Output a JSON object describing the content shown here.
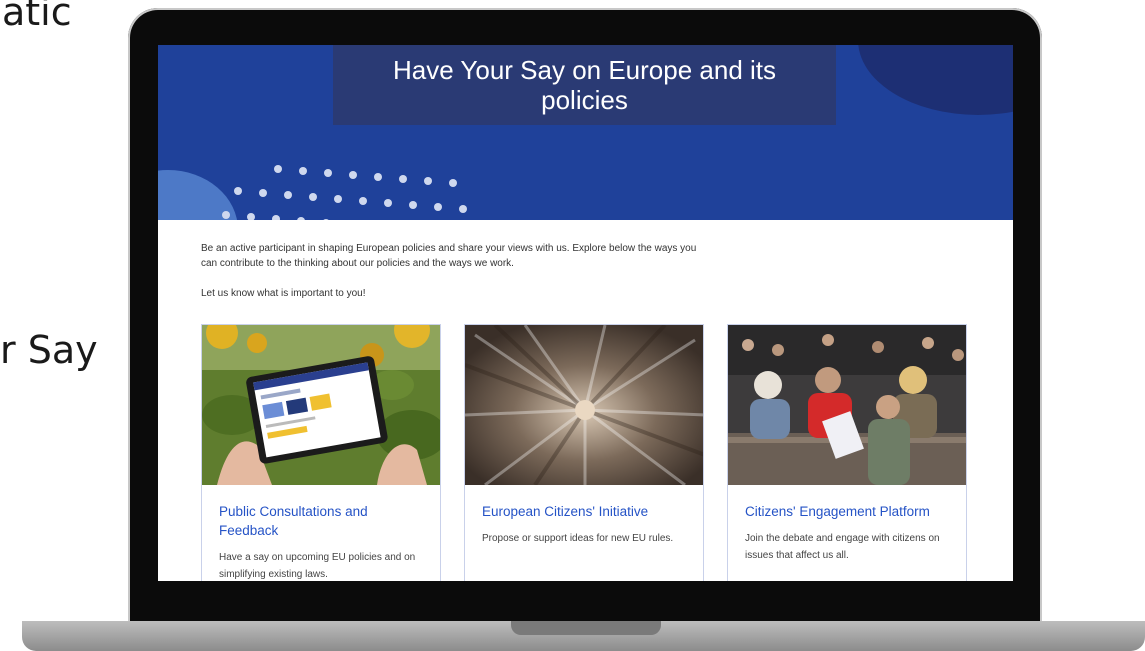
{
  "background": {
    "text_top": "atic",
    "text_mid": "r Say"
  },
  "hero": {
    "title": "Have Your Say on Europe and its policies",
    "colors": {
      "banner": "#1f419a",
      "title_box": "#2a3a74"
    }
  },
  "intro": {
    "paragraph": "Be an active participant in shaping European policies and share your views with us. Explore below the ways you can contribute to the thinking about our policies and the ways we work.",
    "call_to_action": "Let us know what is important to you!"
  },
  "cards": [
    {
      "title": "Public Consultations and Feedback",
      "description": "Have a say on upcoming EU policies and on simplifying existing laws.",
      "image": "tablet-in-sunflowers"
    },
    {
      "title": "European Citizens' Initiative",
      "description": "Propose or support ideas for new EU rules.",
      "image": "crowd-aerial"
    },
    {
      "title": "Citizens' Engagement Platform",
      "description": "Join the debate and engage with citizens on issues that affect us all.",
      "image": "debate-audience"
    }
  ],
  "colors": {
    "link": "#2553c6"
  }
}
